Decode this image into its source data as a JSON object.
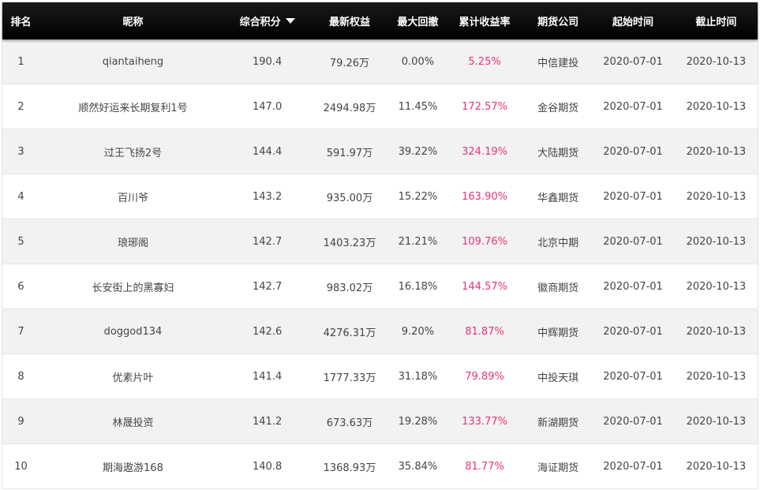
{
  "table": {
    "headers": {
      "rank": "排名",
      "nickname": "昵称",
      "score": "综合积分",
      "equity": "最新权益",
      "drawdown": "最大回撤",
      "return_rate": "累计收益率",
      "broker": "期货公司",
      "start": "起始时间",
      "end": "截止时间"
    },
    "sort_column": "综合积分",
    "sort_direction": "descending",
    "rate_color": "#e8327a",
    "rows": [
      {
        "rank": "1",
        "nickname": "qiantaiheng",
        "score": "190.4",
        "equity": "79.26万",
        "drawdown": "0.00%",
        "return_rate": "5.25%",
        "broker": "中信建投",
        "start": "2020-07-01",
        "end": "2020-10-13"
      },
      {
        "rank": "2",
        "nickname": "顺然好运来长期复利1号",
        "score": "147.0",
        "equity": "2494.98万",
        "drawdown": "11.45%",
        "return_rate": "172.57%",
        "broker": "金谷期货",
        "start": "2020-07-01",
        "end": "2020-10-13"
      },
      {
        "rank": "3",
        "nickname": "过王飞扬2号",
        "score": "144.4",
        "equity": "591.97万",
        "drawdown": "39.22%",
        "return_rate": "324.19%",
        "broker": "大陆期货",
        "start": "2020-07-01",
        "end": "2020-10-13"
      },
      {
        "rank": "4",
        "nickname": "百川爷",
        "score": "143.2",
        "equity": "935.00万",
        "drawdown": "15.22%",
        "return_rate": "163.90%",
        "broker": "华鑫期货",
        "start": "2020-07-01",
        "end": "2020-10-13"
      },
      {
        "rank": "5",
        "nickname": "琅琊阁",
        "score": "142.7",
        "equity": "1403.23万",
        "drawdown": "21.21%",
        "return_rate": "109.76%",
        "broker": "北京中期",
        "start": "2020-07-01",
        "end": "2020-10-13"
      },
      {
        "rank": "6",
        "nickname": "长安街上的黑寡妇",
        "score": "142.7",
        "equity": "983.02万",
        "drawdown": "16.18%",
        "return_rate": "144.57%",
        "broker": "徽商期货",
        "start": "2020-07-01",
        "end": "2020-10-13"
      },
      {
        "rank": "7",
        "nickname": "doggod134",
        "score": "142.6",
        "equity": "4276.31万",
        "drawdown": "9.20%",
        "return_rate": "81.87%",
        "broker": "中辉期货",
        "start": "2020-07-01",
        "end": "2020-10-13"
      },
      {
        "rank": "8",
        "nickname": "优素片叶",
        "score": "141.4",
        "equity": "1777.33万",
        "drawdown": "31.18%",
        "return_rate": "79.89%",
        "broker": "中投天琪",
        "start": "2020-07-01",
        "end": "2020-10-13"
      },
      {
        "rank": "9",
        "nickname": "林晟投资",
        "score": "141.2",
        "equity": "673.63万",
        "drawdown": "19.28%",
        "return_rate": "133.77%",
        "broker": "新湖期货",
        "start": "2020-07-01",
        "end": "2020-10-13"
      },
      {
        "rank": "10",
        "nickname": "期海遨游168",
        "score": "140.8",
        "equity": "1368.93万",
        "drawdown": "35.84%",
        "return_rate": "81.77%",
        "broker": "海证期货",
        "start": "2020-07-01",
        "end": "2020-10-13"
      }
    ]
  }
}
